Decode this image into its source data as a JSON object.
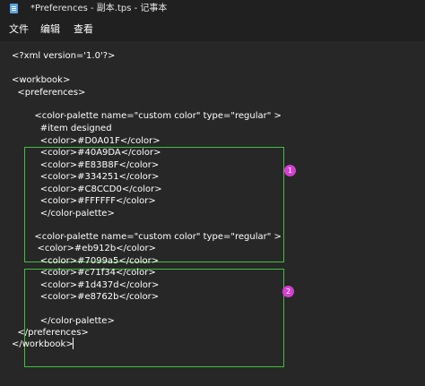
{
  "window": {
    "title": "*Preferences - 副本.tps - 记事本",
    "icon": "notepad-icon"
  },
  "menu": {
    "items": [
      "文件",
      "编辑",
      "查看"
    ]
  },
  "editor": {
    "lines": [
      "<?xml version='1.0'?>",
      "",
      "<workbook>",
      "  <preferences>",
      "",
      "  <color-palette name=\"custom color\" type=\"regular\" >",
      "    #item designed",
      "    <color>#D0A01F</color>",
      "    <color>#40A9DA</color>",
      "    <color>#E83B8F</color>",
      "    <color>#334251</color>",
      "    <color>#C8CCD0</color>",
      "    <color>#FFFFFF</color>",
      "    </color-palette>",
      "",
      "  <color-palette name=\"custom color\" type=\"regular\" >",
      "   <color>#eb912b</color>",
      "    <color>#7099a5</color>",
      "    <color>#c71f34</color>",
      "    <color>#1d437d</color>",
      "    <color>#e8762b</color>",
      "",
      "    </color-palette>",
      "  </preferences>",
      "</workbook>"
    ]
  },
  "annotations": {
    "badge1": "1",
    "badge2": "2",
    "box_color": "#3fbf3f",
    "badge_color": "#d63fd0"
  }
}
